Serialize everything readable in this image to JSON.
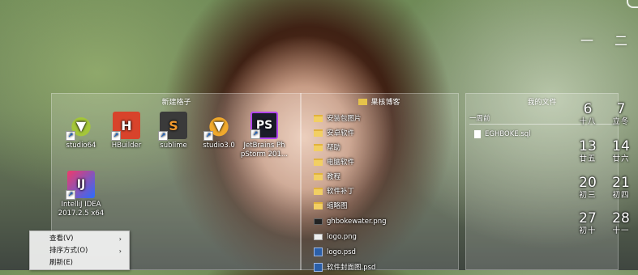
{
  "calendar": {
    "top_numbers": [
      "一",
      "二"
    ],
    "days": [
      {
        "n": "6",
        "l": "十八"
      },
      {
        "n": "7",
        "l": "立冬"
      },
      {
        "n": "13",
        "l": "廿五"
      },
      {
        "n": "14",
        "l": "廿六"
      },
      {
        "n": "20",
        "l": "初三"
      },
      {
        "n": "21",
        "l": "初四"
      },
      {
        "n": "27",
        "l": "初十"
      },
      {
        "n": "28",
        "l": "十一"
      }
    ]
  },
  "panel_new": {
    "title": "新建格子",
    "icons": [
      {
        "label": "studio64"
      },
      {
        "label": "HBuilder"
      },
      {
        "label": "sublime"
      },
      {
        "label": "studio3.0"
      },
      {
        "label": "JetBrains Ph pStorm 201..."
      },
      {
        "label": "IntelliJ IDEA 2017.2.5 x64"
      }
    ]
  },
  "panel_guoke": {
    "title": "果核博客",
    "items": [
      {
        "name": "安装包图片",
        "type": "folder"
      },
      {
        "name": "安卓软件",
        "type": "folder"
      },
      {
        "name": "帮助",
        "type": "folder"
      },
      {
        "name": "电脑软件",
        "type": "folder"
      },
      {
        "name": "教程",
        "type": "folder"
      },
      {
        "name": "软件补丁",
        "type": "folder"
      },
      {
        "name": "缩略图",
        "type": "folder"
      },
      {
        "name": "ghbokewater.png",
        "type": "image"
      },
      {
        "name": "logo.png",
        "type": "image"
      },
      {
        "name": "logo.psd",
        "type": "psd"
      },
      {
        "name": "软件封面图.psd",
        "type": "psd"
      }
    ]
  },
  "panel_docs": {
    "title": "我的文件",
    "section": "一周前",
    "file": "EGHBOKE.sql"
  },
  "context_menu": {
    "items": [
      {
        "label": "查看(V)",
        "arrow": "›"
      },
      {
        "label": "排序方式(O)",
        "arrow": "›"
      },
      {
        "label": "刷新(E)",
        "arrow": ""
      }
    ]
  }
}
